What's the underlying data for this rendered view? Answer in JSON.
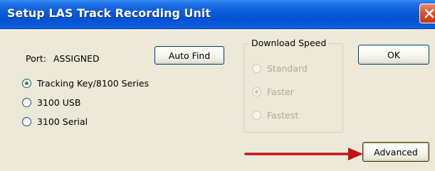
{
  "window": {
    "title": "Setup LAS Track Recording Unit"
  },
  "port": {
    "label": "Port:",
    "value": "ASSIGNED"
  },
  "buttons": {
    "auto_find": "Auto Find",
    "ok": "OK",
    "advanced": "Advanced"
  },
  "device_options": [
    {
      "label": "Tracking Key/8100 Series",
      "checked": true
    },
    {
      "label": "3100 USB",
      "checked": false
    },
    {
      "label": "3100 Serial",
      "checked": false
    }
  ],
  "download_speed": {
    "legend": "Download Speed",
    "enabled": false,
    "options": [
      {
        "label": "Standard",
        "checked": false
      },
      {
        "label": "Faster",
        "checked": true
      },
      {
        "label": "Fastest",
        "checked": false
      }
    ]
  },
  "colors": {
    "title_bar": "#0a5ad8",
    "dialog_face": "#ece9d8",
    "close_button": "#d9532e",
    "annotation_arrow": "#c0141a",
    "radio_checked": "#21a121"
  },
  "icons": {
    "close": "close-x-icon",
    "annotation": "red-arrow-icon"
  }
}
